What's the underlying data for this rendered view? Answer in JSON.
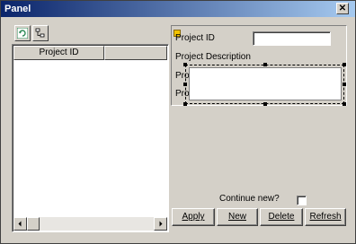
{
  "window": {
    "title": "Panel",
    "close_glyph": "✕"
  },
  "toolbar": {
    "refresh_icon": "refresh-icon",
    "tree_icon": "tree-icon"
  },
  "list": {
    "columns": [
      "Project ID",
      ""
    ]
  },
  "form": {
    "project_id_label": "Project ID",
    "project_id_value": "",
    "project_description_label": "Project Description",
    "obscured_label_1": "Pro",
    "obscured_label_2": "Pro"
  },
  "footer": {
    "continue_label": "Continue new?",
    "continue_checked": false,
    "buttons": {
      "apply": "Apply",
      "new": "New",
      "delete": "Delete",
      "refresh": "Refresh"
    }
  },
  "colors": {
    "title_gradient_start": "#0a246a",
    "title_gradient_end": "#a6caf0",
    "face": "#d4d0c8",
    "refresh_icon_green": "#2e8b57"
  }
}
